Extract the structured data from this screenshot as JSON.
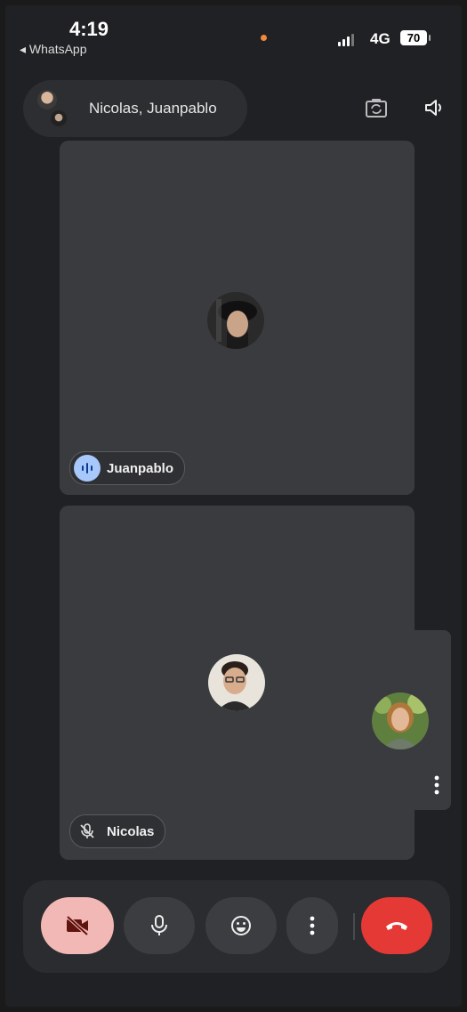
{
  "status_bar": {
    "time": "4:19",
    "back_label": "◂ WhatsApp",
    "network": "4G",
    "battery": "70"
  },
  "header": {
    "title": "Nicolas, Juanpablo"
  },
  "participants": [
    {
      "name": "Juanpablo",
      "state": "speaking",
      "icon": "audio-waveform-icon"
    },
    {
      "name": "Nicolas",
      "state": "muted",
      "icon": "mic-off-icon"
    }
  ],
  "controls": {
    "camera": {
      "icon": "camera-off-icon",
      "state": "off"
    },
    "mic": {
      "icon": "mic-icon"
    },
    "reactions": {
      "icon": "smiley-icon"
    },
    "more": {
      "icon": "more-vertical-icon"
    },
    "end_call": {
      "icon": "hang-up-icon"
    }
  },
  "colors": {
    "background": "#202124",
    "tile": "#3a3b3e",
    "speaking_accent": "#a8c7fa",
    "end_call": "#e53935",
    "camera_off_bg": "#f2b8b5",
    "status_dot": "#f08a3c"
  }
}
